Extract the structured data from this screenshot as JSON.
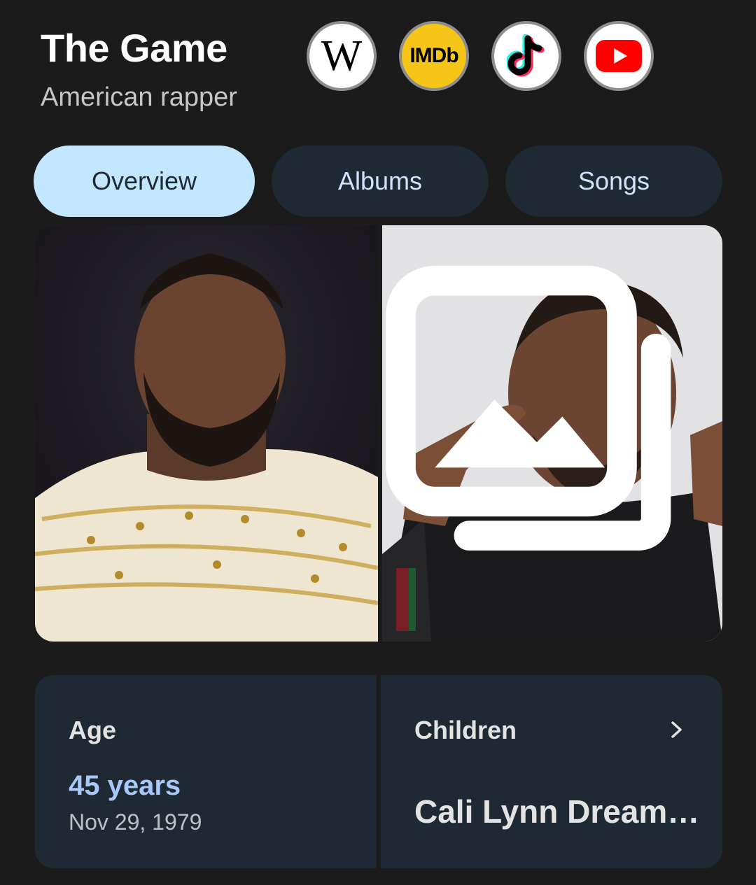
{
  "header": {
    "title": "The Game",
    "subtitle": "American rapper",
    "links": [
      {
        "name": "wikipedia",
        "icon": "wikipedia-icon",
        "glyph": "W"
      },
      {
        "name": "imdb",
        "icon": "imdb-icon",
        "glyph": "IMDb"
      },
      {
        "name": "tiktok",
        "icon": "tiktok-icon"
      },
      {
        "name": "youtube",
        "icon": "youtube-icon"
      }
    ]
  },
  "tabs": [
    {
      "label": "Overview",
      "active": true
    },
    {
      "label": "Albums",
      "active": false
    },
    {
      "label": "Songs",
      "active": false
    }
  ],
  "gallery": {
    "images": [
      "photo-basketball-game",
      "photo-portrait-gesture"
    ],
    "more_icon": "image-gallery-icon"
  },
  "facts": {
    "age": {
      "label": "Age",
      "value": "45 years",
      "date": "Nov 29, 1979"
    },
    "children": {
      "label": "Children",
      "value": "Cali Lynn Dream…",
      "icon": "chevron-right-icon"
    }
  },
  "colors": {
    "background": "#1c1b1b",
    "card": "#1f2933",
    "tab_active": "#c2e7ff",
    "accent_value": "#a8c7fa"
  }
}
